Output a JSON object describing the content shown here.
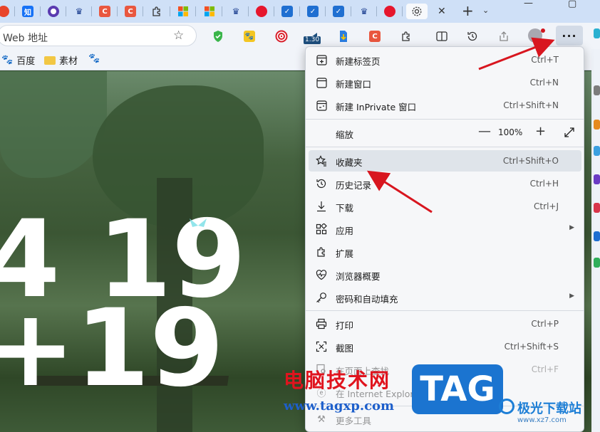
{
  "tabs": [
    {
      "icon": "red-circle-icon",
      "color": "#e8442a"
    },
    {
      "icon": "zhihu-icon",
      "text": "知",
      "color": "#1772f6"
    },
    {
      "icon": "purple-ring-icon",
      "color": "#5b3bb0"
    },
    {
      "icon": "crown-icon",
      "color": "#1a3d8f"
    },
    {
      "icon": "c-app-icon",
      "text": "C",
      "color": "#e9573f"
    },
    {
      "icon": "c-app-icon",
      "text": "C",
      "color": "#e9573f"
    },
    {
      "icon": "puzzle-icon",
      "color": "#333333"
    },
    {
      "icon": "windows-icon",
      "color": "#f25022"
    },
    {
      "icon": "windows-icon",
      "color": "#f25022"
    },
    {
      "icon": "crown-icon",
      "color": "#1a3d8f"
    },
    {
      "icon": "weibo-icon",
      "color": "#e6162d"
    },
    {
      "icon": "check-shield-icon",
      "color": "#1f6fd1"
    },
    {
      "icon": "check-shield-icon",
      "color": "#1f6fd1"
    },
    {
      "icon": "check-shield-icon",
      "color": "#1f6fd1"
    },
    {
      "icon": "crown-icon",
      "color": "#1a3d8f"
    },
    {
      "icon": "weibo-icon",
      "color": "#e6162d"
    },
    {
      "icon": "gear-icon",
      "color": "#444444"
    }
  ],
  "address": {
    "placeholder": "Web 地址"
  },
  "toolbar": {
    "badge": "1.30",
    "more_label": "···"
  },
  "bookmarks": [
    {
      "label": "百度",
      "icon": "paw-icon"
    },
    {
      "label": "素材",
      "icon": "folder-icon"
    }
  ],
  "page": {
    "big_text_1": "4 19",
    "big_text_2": "+19"
  },
  "menu": {
    "items": [
      {
        "label": "新建标签页",
        "shortcut": "Ctrl+T",
        "icon": "new-tab-icon"
      },
      {
        "label": "新建窗口",
        "shortcut": "Ctrl+N",
        "icon": "new-window-icon"
      },
      {
        "label": "新建 InPrivate 窗口",
        "shortcut": "Ctrl+Shift+N",
        "icon": "inprivate-icon"
      },
      {
        "label": "缩放",
        "icon": "zoom-icon"
      },
      {
        "label": "收藏夹",
        "shortcut": "Ctrl+Shift+O",
        "icon": "favorites-icon"
      },
      {
        "label": "历史记录",
        "shortcut": "Ctrl+H",
        "icon": "history-icon"
      },
      {
        "label": "下载",
        "shortcut": "Ctrl+J",
        "icon": "download-icon"
      },
      {
        "label": "应用",
        "icon": "apps-icon"
      },
      {
        "label": "扩展",
        "icon": "extensions-icon"
      },
      {
        "label": "浏览器概要",
        "icon": "browser-essentials-icon"
      },
      {
        "label": "密码和自动填充",
        "icon": "key-icon"
      },
      {
        "label": "打印",
        "shortcut": "Ctrl+P",
        "icon": "print-icon"
      },
      {
        "label": "截图",
        "shortcut": "Ctrl+Shift+S",
        "icon": "screenshot-icon"
      },
      {
        "label": "在页面上查找",
        "shortcut": "Ctrl+F",
        "icon": "find-icon"
      },
      {
        "label": "在 Internet Explorer 模式下重新加载",
        "icon": "ie-icon"
      },
      {
        "label": "更多工具",
        "icon": "more-tools-icon"
      }
    ],
    "zoom": {
      "minus": "—",
      "value": "100%",
      "plus": "+"
    }
  },
  "watermark": {
    "cn": "电脑技术网",
    "url": "www.tagxp.com",
    "tag": "TAG",
    "xz": "极光下载站",
    "xz_url": "www.xz7.com"
  },
  "colors": {
    "accent": "#1b74d0",
    "arrow": "#d8161f"
  }
}
